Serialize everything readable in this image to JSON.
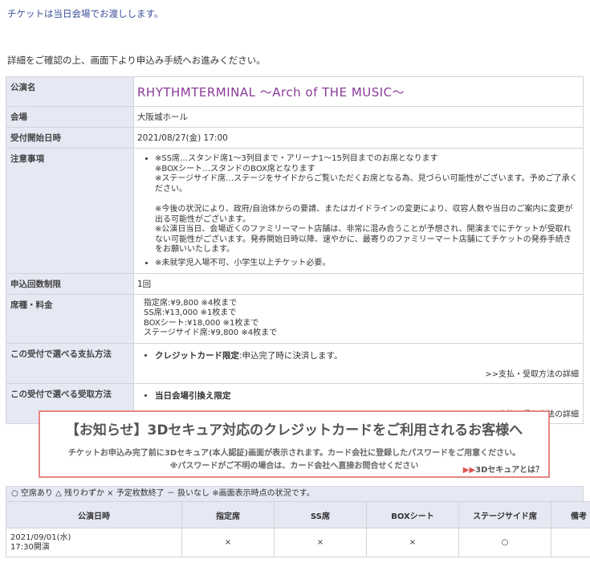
{
  "notice": "チケットは当日会場でお渡しします。",
  "detail_instruction": "詳細をご確認の上、画面下より申込み手続へお進みください。",
  "info": {
    "performance_name_label": "公演名",
    "performance_name": "RHYTHMTERMINAL ～Arch of THE MUSIC～",
    "venue_label": "会場",
    "venue": "大阪城ホール",
    "start_label": "受付開始日時",
    "start": "2021/08/27(金) 17:00",
    "notes_label": "注意事項",
    "notes": [
      "※SS席…スタンド席1～3列目まで・アリーナ1～15列目までのお席となります\n※BOXシート…スタンドのBOX席となります\n※ステージサイド席…ステージをサイドからご覧いただくお席となる為、見づらい可能性がございます。予めご了承ください。\n\n※今後の状況により、政府/自治体からの要請、またはガイドラインの変更により、収容人数や当日のご案内に変更が出る可能性がございます。\n※公演日当日、会場近くのファミリーマート店舗は、非常に混み合うことが予想され、開演までにチケットが受取れない可能性がございます。発券開始日時以降、速やかに、最寄りのファミリーマート店舗にてチケットの発券手続きをお願いいたします。",
      "※未就学児入場不可、小学生以上チケット必要。"
    ],
    "limit_label": "申込回数制限",
    "limit": "1回",
    "price_label": "席種・料金",
    "prices": [
      "指定席:¥9,800 ※4枚まで",
      "SS席:¥13,000 ※1枚まで",
      "BOXシート:¥18,000 ※1枚まで",
      "ステージサイド席:¥9,800 ※4枚まで"
    ],
    "payment_label": "この受付で選べる支払方法",
    "payment_method": "クレジットカード限定",
    "payment_note": ":申込完了時に決済します。",
    "payment_link": ">>支払・受取方法の詳細",
    "receive_label": "この受付で選べる受取方法",
    "receive_method": "当日会場引換え限定",
    "receive_link": ">>支払・受取方法の詳細"
  },
  "banner": {
    "title": "【お知らせ】3Dセキュア対応のクレジットカードをご利用されるお客様へ",
    "line1": "チケットお申込み完了前に3Dセキュア(本人認証)画面が表示されます。カード会社に登録したパスワードをご用意ください。",
    "line2": "※パスワードがご不明の場合は、カード会社へ直接お問合せください",
    "link_arrow": "▶▶",
    "link": "3Dセキュアとは？"
  },
  "legend": "○ 空席あり △ 残りわずか × 予定枚数終了 － 扱いなし ※画面表示時点の状況です。",
  "schedule": {
    "headers": [
      "公演日時",
      "指定席",
      "SS席",
      "BOXシート",
      "ステージサイド席",
      "備考"
    ],
    "rows": [
      {
        "date": "2021/09/01(水)",
        "time": "17:30開演",
        "cells": [
          "×",
          "×",
          "×",
          "○",
          ""
        ]
      }
    ]
  }
}
